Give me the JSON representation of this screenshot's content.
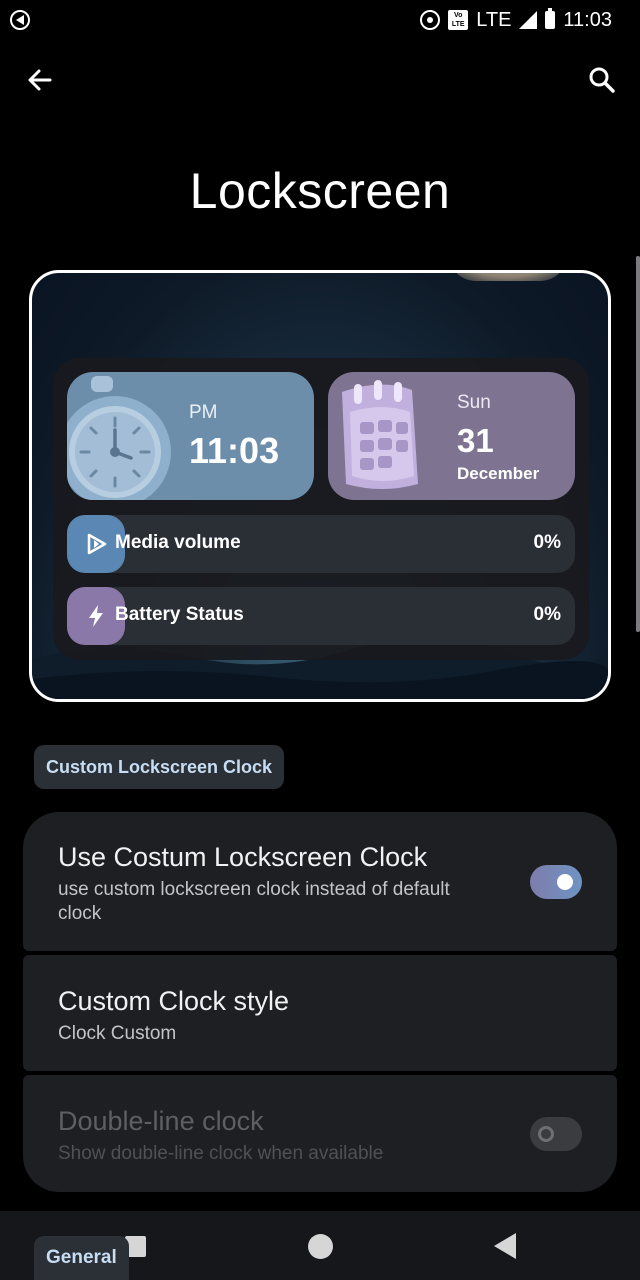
{
  "status_bar": {
    "network": "LTE",
    "volte": "Vo LTE",
    "time": "11:03"
  },
  "header": {
    "title": "Lockscreen",
    "back_icon": "arrow-left-icon",
    "search_icon": "search-icon"
  },
  "preview": {
    "clock": {
      "ampm": "PM",
      "time": "11:03"
    },
    "date": {
      "day": "Sun",
      "number": "31",
      "month": "December"
    },
    "media": {
      "label": "Media volume",
      "value": "0%"
    },
    "battery": {
      "label": "Battery Status",
      "value": "0%"
    }
  },
  "section": {
    "label": "Custom Lockscreen Clock"
  },
  "settings": [
    {
      "title": "Use Costum Lockscreen Clock",
      "subtitle": "use custom lockscreen clock instead of default clock",
      "toggle": true
    },
    {
      "title": "Custom Clock style",
      "subtitle": "Clock Custom"
    },
    {
      "title": "Double-line clock",
      "subtitle": "Show double-line clock when available",
      "toggle": false,
      "disabled": true
    }
  ],
  "bottom": {
    "general_label": "General"
  },
  "colors": {
    "accent_blue": "#6d8eab",
    "accent_purple": "#7e7491",
    "chip_text": "#c6ddf3",
    "card_bg": "#1e1f22"
  }
}
